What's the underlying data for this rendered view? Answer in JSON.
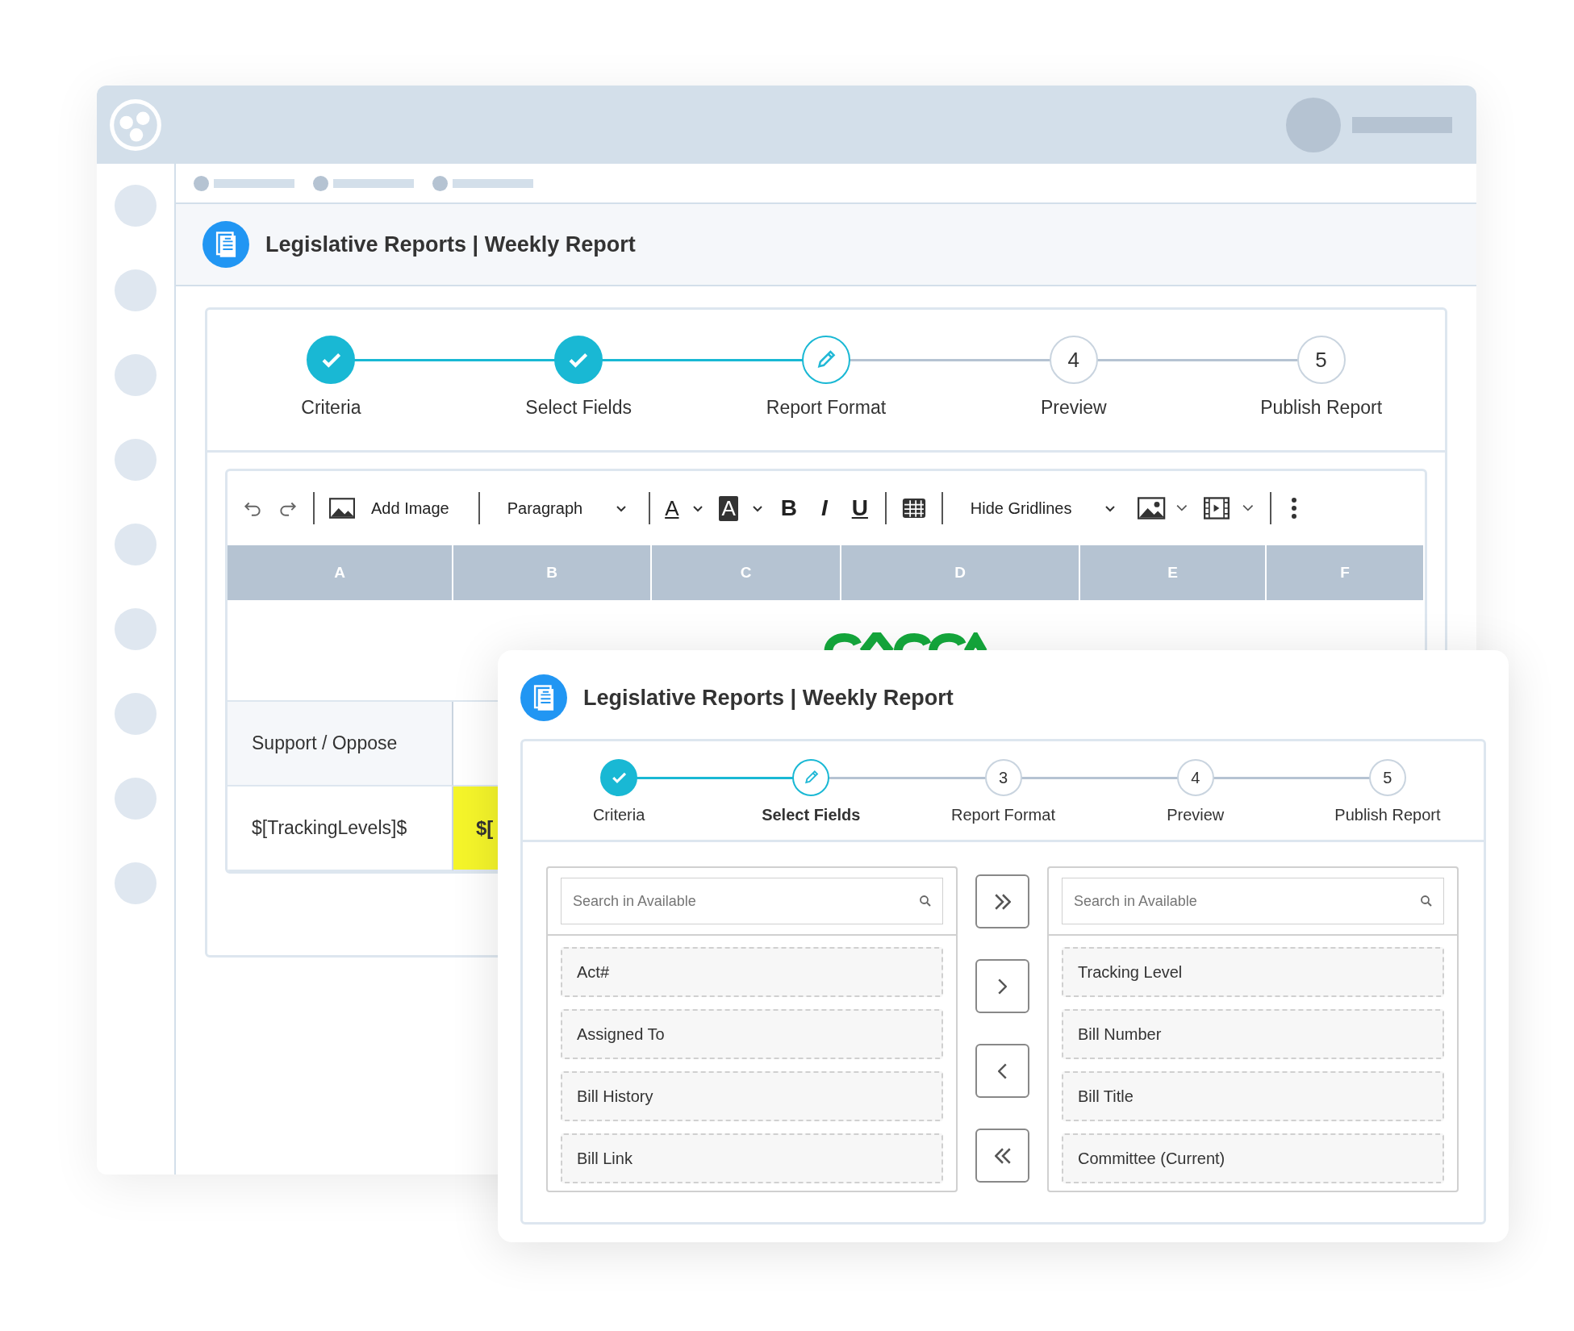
{
  "back": {
    "title": "Legislative Reports | Weekly Report",
    "steps": [
      {
        "label": "Criteria",
        "done": true
      },
      {
        "label": "Select Fields",
        "done": true
      },
      {
        "label": "Report Format",
        "done": false,
        "current": true
      },
      {
        "label": "Preview",
        "done": false,
        "current": false,
        "number": "4"
      },
      {
        "label": "Publish Report",
        "done": false,
        "current": false,
        "number": "5"
      }
    ],
    "toolbar": [
      {
        "kind": "undo"
      },
      {
        "kind": "redo"
      },
      {
        "kind": "sep"
      },
      {
        "kind": "image",
        "label": "Add Image"
      },
      {
        "kind": "sep"
      },
      {
        "kind": "dropdown",
        "label": "Paragraph"
      },
      {
        "kind": "sep"
      },
      {
        "kind": "fontcolor",
        "label": "A"
      },
      {
        "kind": "highlight",
        "label": "A"
      },
      {
        "kind": "bold",
        "label": "B"
      },
      {
        "kind": "italic",
        "label": "I"
      },
      {
        "kind": "underline",
        "label": "U"
      },
      {
        "kind": "sep"
      },
      {
        "kind": "table"
      },
      {
        "kind": "sep"
      },
      {
        "kind": "dropdown",
        "label": "Hide Gridlines"
      },
      {
        "kind": "picture"
      },
      {
        "kind": "video"
      },
      {
        "kind": "sep"
      },
      {
        "kind": "more"
      }
    ],
    "columns": [
      "A",
      "B",
      "C",
      "D",
      "E",
      "F"
    ],
    "rows": [
      {
        "label": "Support / Oppose",
        "highlight": false
      },
      {
        "label": "$[TrackingLevels]$",
        "value": "$[",
        "highlight": true
      }
    ]
  },
  "dialog": {
    "title": "Legislative Reports | Weekly Report",
    "steps": [
      {
        "label": "Criteria",
        "done": true
      },
      {
        "label": "Select Fields",
        "done": false,
        "current": true
      },
      {
        "label": "Report Format",
        "done": false,
        "current": false,
        "number": "3"
      },
      {
        "label": "Preview",
        "done": false,
        "current": false,
        "number": "4"
      },
      {
        "label": "Publish Report",
        "done": false,
        "current": false,
        "number": "5"
      }
    ],
    "available": {
      "placeholder": "Search in Available",
      "items": [
        "Act#",
        "Assigned To",
        "Bill History",
        "Bill Link"
      ]
    },
    "selected": {
      "placeholder": "Search in Available",
      "items": [
        "Tracking Level",
        "Bill Number",
        "Bill Title",
        "Committee (Current)"
      ]
    },
    "transfer": [
      {
        "kind": "all-right"
      },
      {
        "kind": "right"
      },
      {
        "kind": "left"
      },
      {
        "kind": "all-left"
      }
    ]
  }
}
